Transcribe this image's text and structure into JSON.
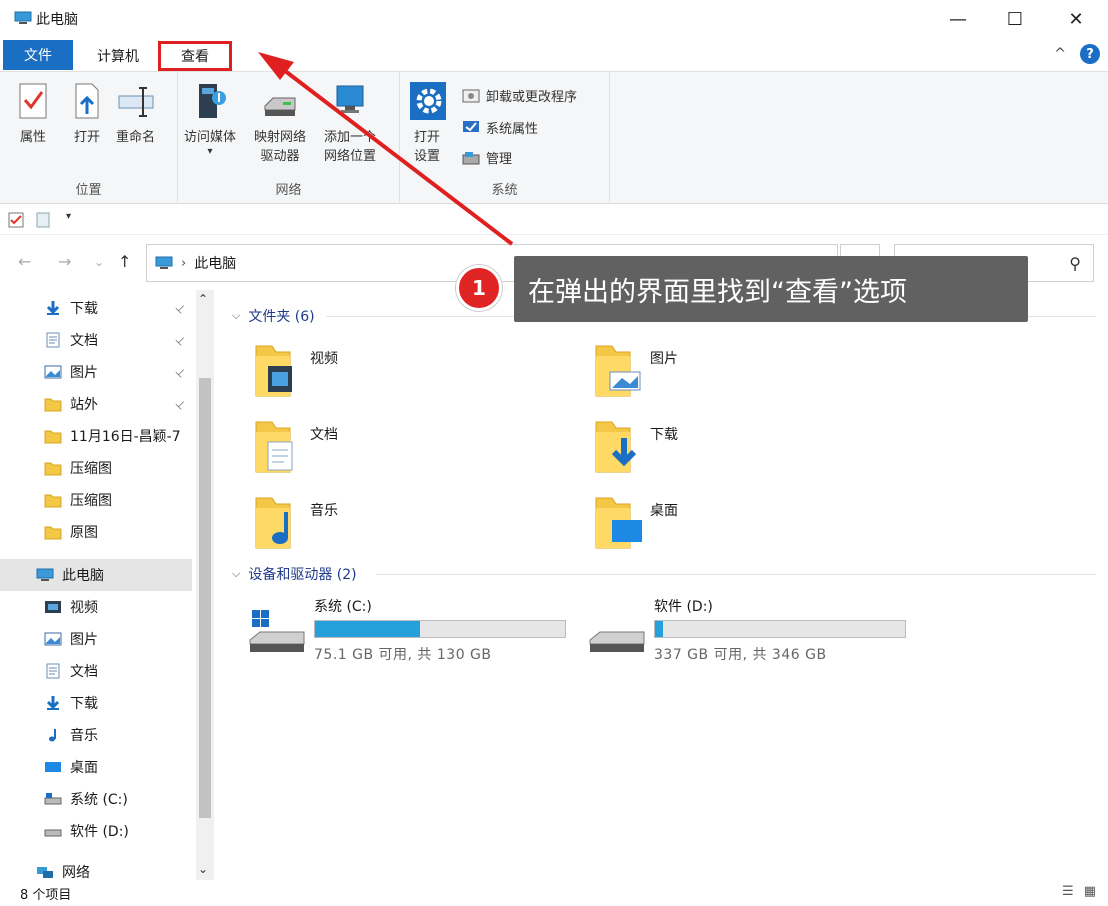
{
  "window": {
    "title": "此电脑",
    "min_glyph": "—",
    "max_glyph": "☐",
    "close_glyph": "✕"
  },
  "tabs": {
    "file": "文件",
    "computer": "计算机",
    "view": "查看",
    "collapse_glyph": "^",
    "help_glyph": "?"
  },
  "ribbon": {
    "location": {
      "name": "位置",
      "properties": "属性",
      "open": "打开",
      "rename": "重命名"
    },
    "network": {
      "name": "网络",
      "media_line1": "访问媒体",
      "map_line1": "映射网络",
      "map_line2": "驱动器",
      "add_line1": "添加一个",
      "add_line2": "网络位置"
    },
    "system": {
      "name": "系统",
      "settings_line1": "打开",
      "settings_line2": "设置",
      "uninstall": "卸载或更改程序",
      "sysprops": "系统属性",
      "manage": "管理"
    }
  },
  "address": {
    "path": "此电脑",
    "back_glyph": "←",
    "forward_glyph": "→",
    "dropdown_glyph": "⌄",
    "up_glyph": "↑",
    "refresh_glyph": "↻",
    "search_glyph": "⚲"
  },
  "sidebar": {
    "quick": [
      {
        "label": "下载",
        "icon": "download-icon",
        "pinned": true
      },
      {
        "label": "文档",
        "icon": "document-icon",
        "pinned": true
      },
      {
        "label": "图片",
        "icon": "pictures-icon",
        "pinned": true
      },
      {
        "label": "站外",
        "icon": "folder-icon",
        "pinned": true
      },
      {
        "label": "11月16日-昌颖-7",
        "icon": "folder-icon",
        "pinned": false
      },
      {
        "label": "压缩图",
        "icon": "folder-icon",
        "pinned": false
      },
      {
        "label": "压缩图",
        "icon": "folder-icon",
        "pinned": false
      },
      {
        "label": "原图",
        "icon": "folder-icon",
        "pinned": false
      }
    ],
    "this_pc": "此电脑",
    "pc_items": [
      {
        "label": "视频",
        "icon": "video-icon"
      },
      {
        "label": "图片",
        "icon": "pictures-icon"
      },
      {
        "label": "文档",
        "icon": "document-icon"
      },
      {
        "label": "下载",
        "icon": "download-icon"
      },
      {
        "label": "音乐",
        "icon": "music-icon"
      },
      {
        "label": "桌面",
        "icon": "desktop-icon"
      },
      {
        "label": "系统 (C:)",
        "icon": "drive-c-icon"
      },
      {
        "label": "软件 (D:)",
        "icon": "drive-d-icon"
      }
    ],
    "network": "网络",
    "pin_glyph": "📌"
  },
  "content": {
    "folders_header": "文件夹 (6)",
    "folders": [
      "视频",
      "图片",
      "文档",
      "下载",
      "音乐",
      "桌面"
    ],
    "drives_header": "设备和驱动器 (2)",
    "drives": [
      {
        "name": "系统 (C:)",
        "size": "75.1 GB 可用, 共 130 GB",
        "used_fraction": 0.42
      },
      {
        "name": "软件 (D:)",
        "size": "337 GB 可用, 共 346 GB",
        "used_fraction": 0.03
      }
    ]
  },
  "status": {
    "count": "8 个项目"
  },
  "annotation": {
    "number": "1",
    "text": "在弹出的界面里找到“查看”选项"
  },
  "colors": {
    "accent": "#1a6fc4",
    "highlight": "#e02020",
    "drive_bar": "#26a0da",
    "folder": "#f5c746"
  }
}
